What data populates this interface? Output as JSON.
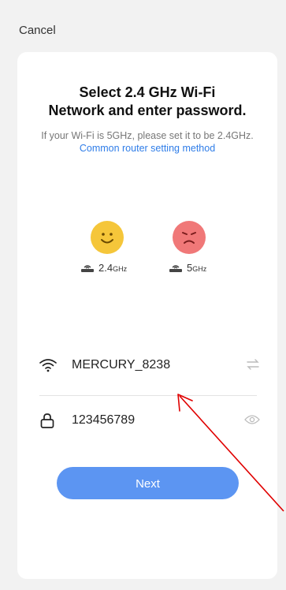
{
  "header": {
    "cancel_label": "Cancel"
  },
  "card": {
    "title": "Select 2.4 GHz Wi-Fi\nNetwork and enter password.",
    "hint_text": "If your Wi-Fi is 5GHz, please set it to be 2.4GHz. ",
    "hint_link": "Common router setting method"
  },
  "bands": {
    "supported": {
      "label": "2.4",
      "unit": "GHz",
      "face": "smile-icon"
    },
    "unsupported": {
      "label": "5",
      "unit": "GHz",
      "face": "frown-icon"
    }
  },
  "form": {
    "wifi_name": "MERCURY_8238",
    "password": "123456789",
    "next_label": "Next"
  },
  "colors": {
    "accent": "#5c95f2",
    "link": "#2f7de8",
    "happy": "#f5c63a",
    "sad": "#f07878",
    "annotation_arrow": "#e00000"
  }
}
